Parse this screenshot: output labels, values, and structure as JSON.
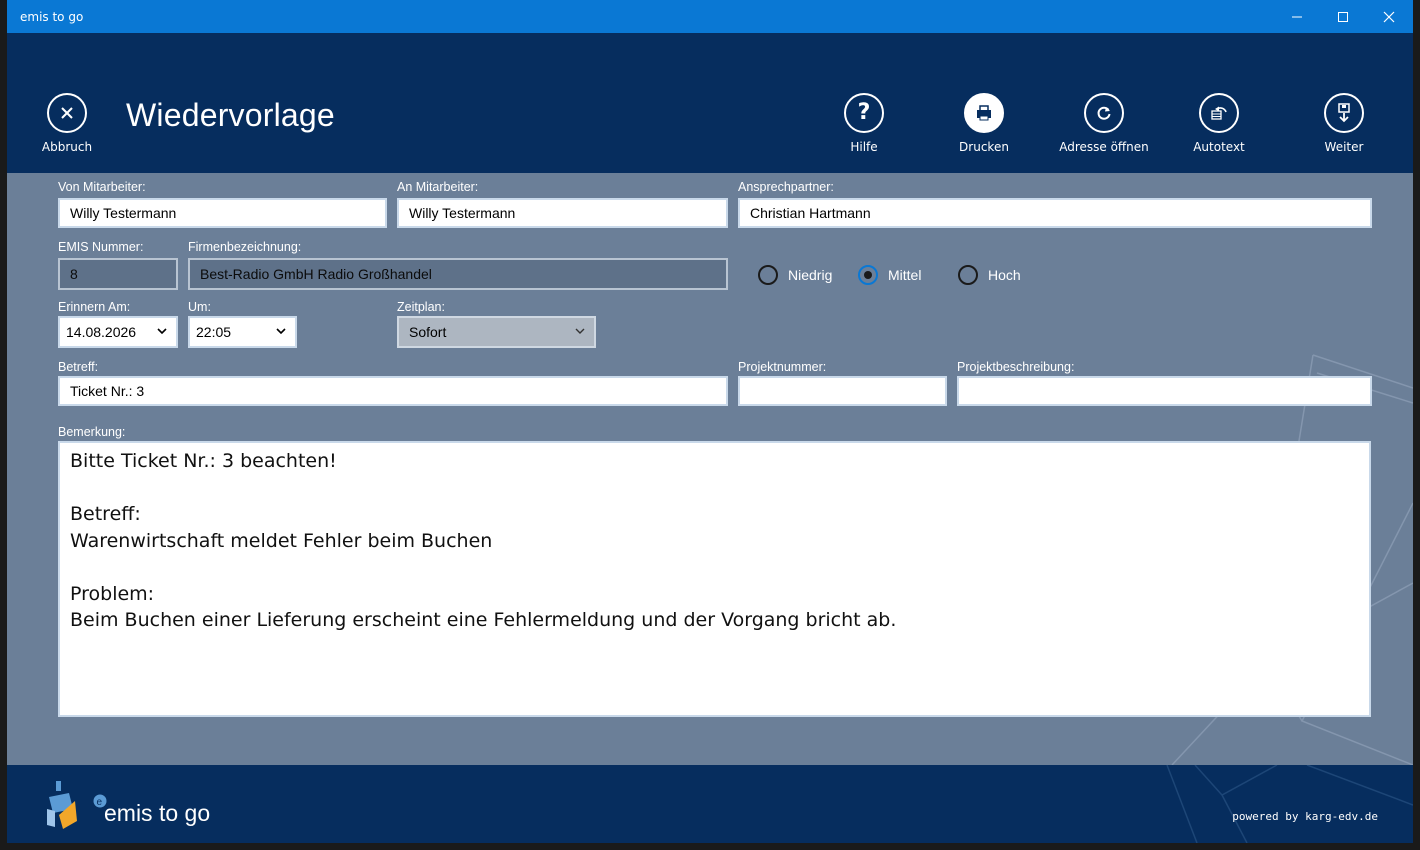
{
  "window": {
    "title": "emis to go"
  },
  "header": {
    "page_title": "Wiedervorlage",
    "buttons": {
      "cancel": "Abbruch",
      "help": "Hilfe",
      "print": "Drucken",
      "open_address": "Adresse öffnen",
      "autotext": "Autotext",
      "next": "Weiter"
    }
  },
  "form": {
    "von_mitarbeiter": {
      "label": "Von Mitarbeiter:",
      "value": "Willy Testermann"
    },
    "an_mitarbeiter": {
      "label": "An Mitarbeiter:",
      "value": "Willy Testermann"
    },
    "ansprechpartner": {
      "label": "Ansprechpartner:",
      "value": "Christian Hartmann"
    },
    "emis_nummer": {
      "label": "EMIS Nummer:",
      "value": "8"
    },
    "firmenbezeichnung": {
      "label": "Firmenbezeichnung:",
      "value": "Best-Radio GmbH Radio Großhandel"
    },
    "priority": {
      "options": [
        "Niedrig",
        "Mittel",
        "Hoch"
      ],
      "selected": "Mittel"
    },
    "erinnern_am": {
      "label": "Erinnern Am:",
      "value": "14.08.2026"
    },
    "um": {
      "label": "Um:",
      "value": "22:05"
    },
    "zeitplan": {
      "label": "Zeitplan:",
      "value": "Sofort"
    },
    "betreff": {
      "label": "Betreff:",
      "value": "Ticket Nr.: 3"
    },
    "projektnummer": {
      "label": "Projektnummer:",
      "value": ""
    },
    "projektbeschreibung": {
      "label": "Projektbeschreibung:",
      "value": ""
    },
    "bemerkung": {
      "label": "Bemerkung:",
      "value": "Bitte Ticket Nr.: 3 beachten!\n\nBetreff:\nWarenwirtschaft meldet Fehler beim Buchen\n\nProblem:\nBeim Buchen einer Lieferung erscheint eine Fehlermeldung und der Vorgang bricht ab."
    }
  },
  "footer": {
    "brand": "emis to go",
    "powered": "powered by karg-edv.de"
  },
  "colors": {
    "titlebar": "#0a78d4",
    "header": "#062d5e",
    "content_bg": "#6b7f98"
  },
  "icons": [
    "close-circle-icon",
    "help-icon",
    "print-icon",
    "refresh-icon",
    "autotext-icon",
    "save-download-icon",
    "minimize-icon",
    "maximize-icon",
    "close-icon",
    "chevron-down-icon",
    "logo-icon"
  ]
}
